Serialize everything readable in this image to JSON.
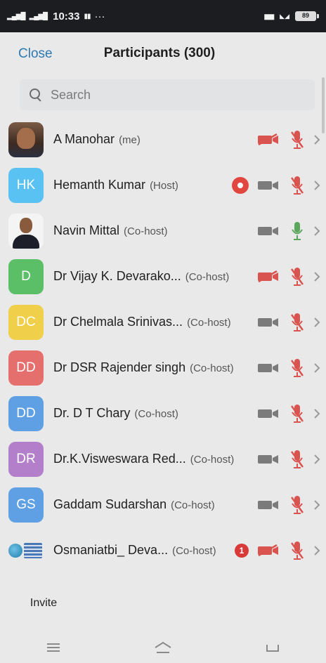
{
  "status": {
    "time": "10:33",
    "battery": "89"
  },
  "header": {
    "close_label": "Close",
    "title": "Participants (300)"
  },
  "search": {
    "placeholder": "Search"
  },
  "participants": [
    {
      "name": "A Manohar",
      "role": "(me)",
      "avatar_initials": "",
      "avatar_type": "photo1",
      "video_on": false,
      "mic_on": false,
      "recording": false,
      "unread": ""
    },
    {
      "name": "Hemanth Kumar",
      "role": "(Host)",
      "avatar_initials": "HK",
      "avatar_color": "#5ac2f2",
      "video_on": true,
      "mic_on": false,
      "recording": true,
      "unread": ""
    },
    {
      "name": "Navin Mittal",
      "role": "(Co-host)",
      "avatar_initials": "",
      "avatar_type": "photo2",
      "video_on": true,
      "mic_on": true,
      "recording": false,
      "unread": ""
    },
    {
      "name": "Dr  Vijay K. Devarako...",
      "role": "(Co-host)",
      "avatar_initials": "D",
      "avatar_color": "#5bbf67",
      "video_on": false,
      "mic_on": false,
      "recording": false,
      "unread": ""
    },
    {
      "name": "Dr Chelmala Srinivas...",
      "role": "(Co-host)",
      "avatar_initials": "DC",
      "avatar_color": "#f0cf4a",
      "video_on": true,
      "mic_on": false,
      "recording": false,
      "unread": ""
    },
    {
      "name": "Dr DSR Rajender singh",
      "role": "(Co-host)",
      "avatar_initials": "DD",
      "avatar_color": "#e56f6c",
      "video_on": true,
      "mic_on": false,
      "recording": false,
      "unread": ""
    },
    {
      "name": "Dr. D T Chary",
      "role": "(Co-host)",
      "avatar_initials": "DD",
      "avatar_color": "#5fa0e4",
      "video_on": true,
      "mic_on": false,
      "recording": false,
      "unread": ""
    },
    {
      "name": "Dr.K.Visweswara Red...",
      "role": "(Co-host)",
      "avatar_initials": "DR",
      "avatar_color": "#b47fca",
      "video_on": true,
      "mic_on": false,
      "recording": false,
      "unread": ""
    },
    {
      "name": "Gaddam Sudarshan",
      "role": "(Co-host)",
      "avatar_initials": "GS",
      "avatar_color": "#5fa0e4",
      "video_on": true,
      "mic_on": false,
      "recording": false,
      "unread": ""
    },
    {
      "name": "Osmaniatbi_ Deva...",
      "role": "(Co-host)",
      "avatar_initials": "",
      "avatar_type": "logo",
      "video_on": false,
      "mic_on": false,
      "recording": false,
      "unread": "1"
    }
  ],
  "footer": {
    "invite_label": "Invite"
  },
  "colors": {
    "accent": "#2d7ab3",
    "muted_red": "#d9534f",
    "video_gray": "#7b7b7b",
    "mic_green": "#5aa65c"
  }
}
